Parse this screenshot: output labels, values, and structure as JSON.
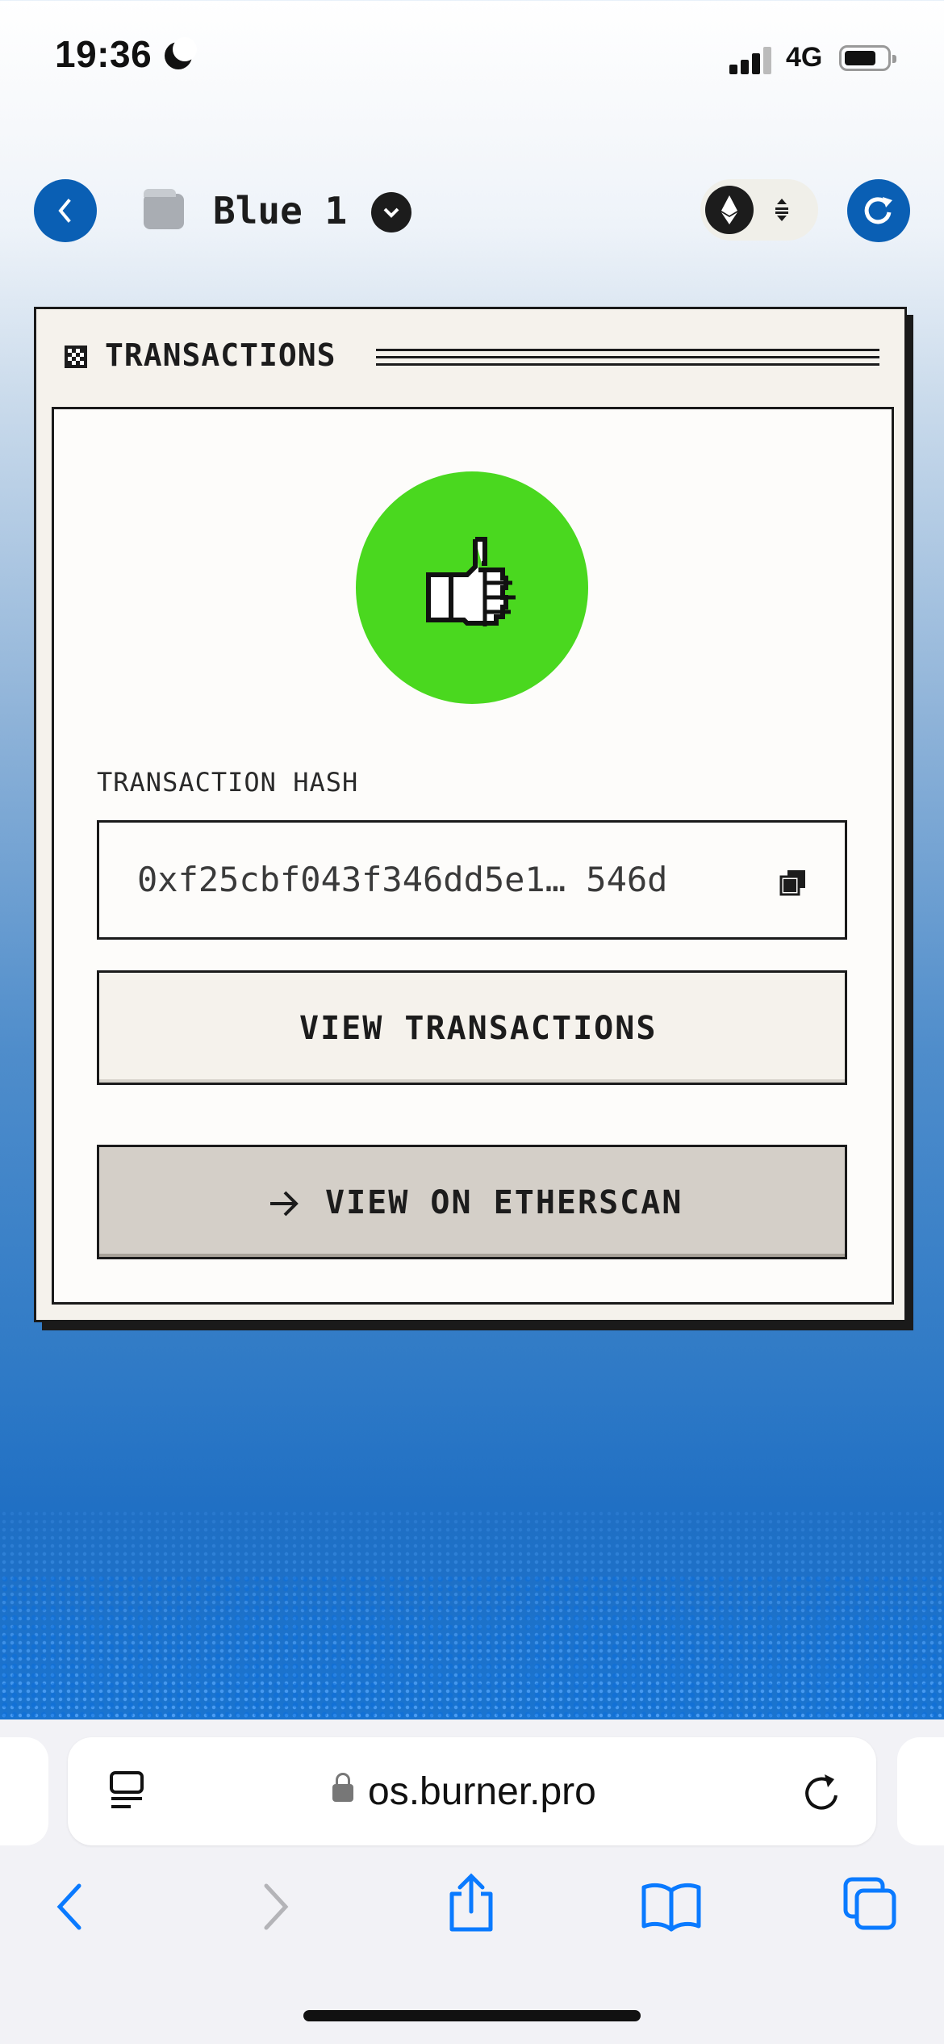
{
  "status_bar": {
    "time": "19:36",
    "network": "4G",
    "battery_level": 0.7
  },
  "header": {
    "back_icon": "chevron-left-icon",
    "wallet_name": "Blue 1",
    "wallet_icon": "wallet-icon",
    "dropdown_icon": "chevron-down-icon",
    "network_icon": "ethereum-icon",
    "switch_icon": "swap-icon",
    "refresh_icon": "refresh-icon"
  },
  "card": {
    "title": "TRANSACTIONS",
    "status_icon": "thumbs-up-icon",
    "hash_label": "TRANSACTION HASH",
    "hash_value": "0xf25cbf043f346dd5e1… 546d",
    "view_transactions_label": "VIEW TRANSACTIONS",
    "etherscan_label": "VIEW ON ETHERSCAN"
  },
  "browser": {
    "url": "os.burner.pro"
  },
  "colors": {
    "accent": "#0a5fb4",
    "success": "#4ad81f",
    "card_bg": "#f5f2ec"
  }
}
